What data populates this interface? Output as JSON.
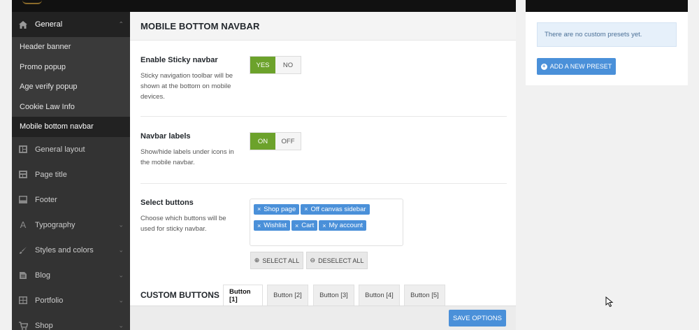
{
  "sidebar": {
    "general": {
      "label": "General",
      "icon": "home-icon"
    },
    "sub_items": [
      {
        "label": "Header banner"
      },
      {
        "label": "Promo popup"
      },
      {
        "label": "Age verify popup"
      },
      {
        "label": "Cookie Law Info"
      },
      {
        "label": "Mobile bottom navbar"
      }
    ],
    "items": [
      {
        "label": "General layout",
        "icon": "layout-icon"
      },
      {
        "label": "Page title",
        "icon": "page-title-icon"
      },
      {
        "label": "Footer",
        "icon": "footer-icon"
      },
      {
        "label": "Typography",
        "icon": "typography-icon"
      },
      {
        "label": "Styles and colors",
        "icon": "brush-icon"
      },
      {
        "label": "Blog",
        "icon": "blog-icon"
      },
      {
        "label": "Portfolio",
        "icon": "portfolio-icon"
      },
      {
        "label": "Shop",
        "icon": "cart-icon"
      }
    ]
  },
  "main": {
    "title": "MOBILE BOTTOM NAVBAR",
    "sticky": {
      "title": "Enable Sticky navbar",
      "desc": "Sticky navigation toolbar will be shown at the bottom on mobile devices.",
      "yes": "YES",
      "no": "NO",
      "selected": "YES"
    },
    "labels": {
      "title": "Navbar labels",
      "desc": "Show/hide labels under icons in the mobile navbar.",
      "on": "ON",
      "off": "OFF",
      "selected": "ON"
    },
    "select_buttons": {
      "title": "Select buttons",
      "desc": "Choose which buttons will be used for sticky navbar.",
      "tags": [
        "Shop page",
        "Off canvas sidebar",
        "Wishlist",
        "Cart",
        "My account"
      ],
      "select_all": "SELECT ALL",
      "deselect_all": "DESELECT ALL"
    },
    "custom_buttons": {
      "title": "CUSTOM BUTTONS",
      "tabs": [
        "Button [1]",
        "Button [2]",
        "Button [3]",
        "Button [4]",
        "Button [5]"
      ],
      "active_tab": "Button [1]"
    },
    "save": "SAVE OPTIONS"
  },
  "presets": {
    "notice": "There are no custom presets yet.",
    "add": "ADD A NEW PRESET"
  },
  "colors": {
    "accent": "#4a90d9",
    "toggle_on": "#6ca22b",
    "sidebar_bg": "#333333"
  }
}
